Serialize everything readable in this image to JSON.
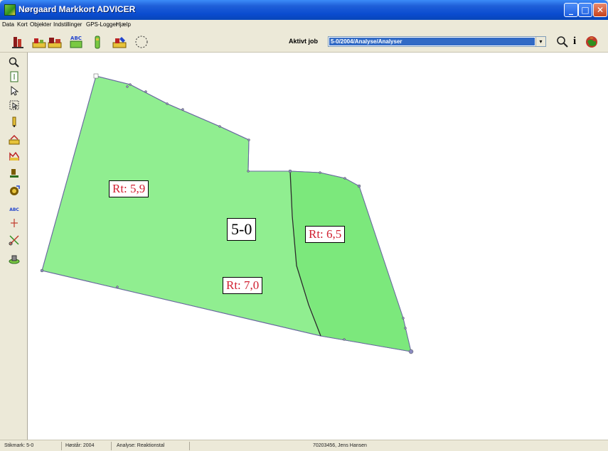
{
  "window": {
    "title": "Nørgaard Markkort ADVICER",
    "controls": {
      "minimize": "_",
      "maximize": "□",
      "close": "✕"
    }
  },
  "menu": [
    "Data",
    "Kort",
    "Objekter",
    "Indstillinger",
    "GPS-Logger",
    "Hjælp"
  ],
  "toolbar": {
    "tools": [
      "farm-icon",
      "field-icon",
      "fields-icon",
      "abc-map-icon",
      "bottle-icon",
      "map-edit-icon",
      "select-area-icon"
    ],
    "job_label": "Aktivt job",
    "job_value": "5-0/2004/Analyse/Analyser",
    "dropdown_arrow": "▾",
    "right_tools": [
      "search-icon",
      "info-icon",
      "globe-icon"
    ],
    "info_glyph": "i"
  },
  "left_tools": [
    "zoom-icon",
    "page-icon",
    "pointer-icon",
    "select-icon",
    "pin-icon",
    "field-draw-icon",
    "graph-icon",
    "measure-icon",
    "move-icon",
    "abc-icon",
    "axis-icon",
    "scissors-icon",
    "stamp-icon"
  ],
  "left_tools_text": {
    "abc": "ABC"
  },
  "map": {
    "field_name": "5-0",
    "zones": [
      {
        "label": "Rt: 5,9",
        "color": "#90ee90"
      },
      {
        "label": "Rt: 7,0",
        "color": "#90ee90"
      },
      {
        "label": "Rt: 6,5",
        "color": "#7ce87c"
      }
    ],
    "outline_color": "#6a6aa0",
    "divider_color": "#2a2a2a"
  },
  "status": {
    "field": "Stikmark: 5-0",
    "harvest": "Høstår: 2004",
    "analysis": "Analyse: Reaktionstal",
    "user": "70203456, Jens Hansen"
  }
}
